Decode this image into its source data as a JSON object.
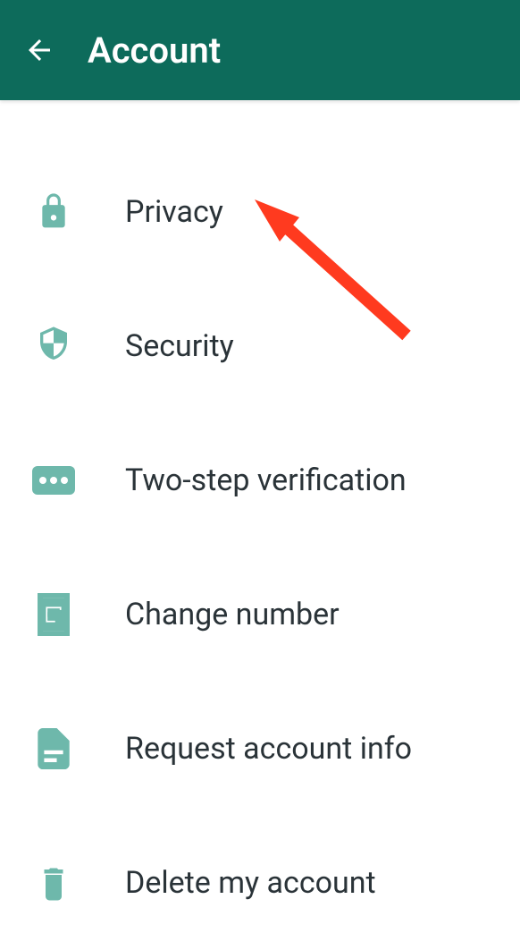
{
  "header": {
    "title": "Account"
  },
  "menu": {
    "items": [
      {
        "id": "privacy",
        "label": "Privacy",
        "icon": "lock-icon"
      },
      {
        "id": "security",
        "label": "Security",
        "icon": "shield-icon"
      },
      {
        "id": "two-step",
        "label": "Two-step verification",
        "icon": "dots-icon"
      },
      {
        "id": "change-number",
        "label": "Change number",
        "icon": "sim-icon"
      },
      {
        "id": "request-info",
        "label": "Request account info",
        "icon": "document-icon"
      },
      {
        "id": "delete",
        "label": "Delete my account",
        "icon": "trash-icon"
      }
    ]
  },
  "annotation": {
    "type": "arrow",
    "color": "#ff3a1f",
    "target": "privacy"
  }
}
